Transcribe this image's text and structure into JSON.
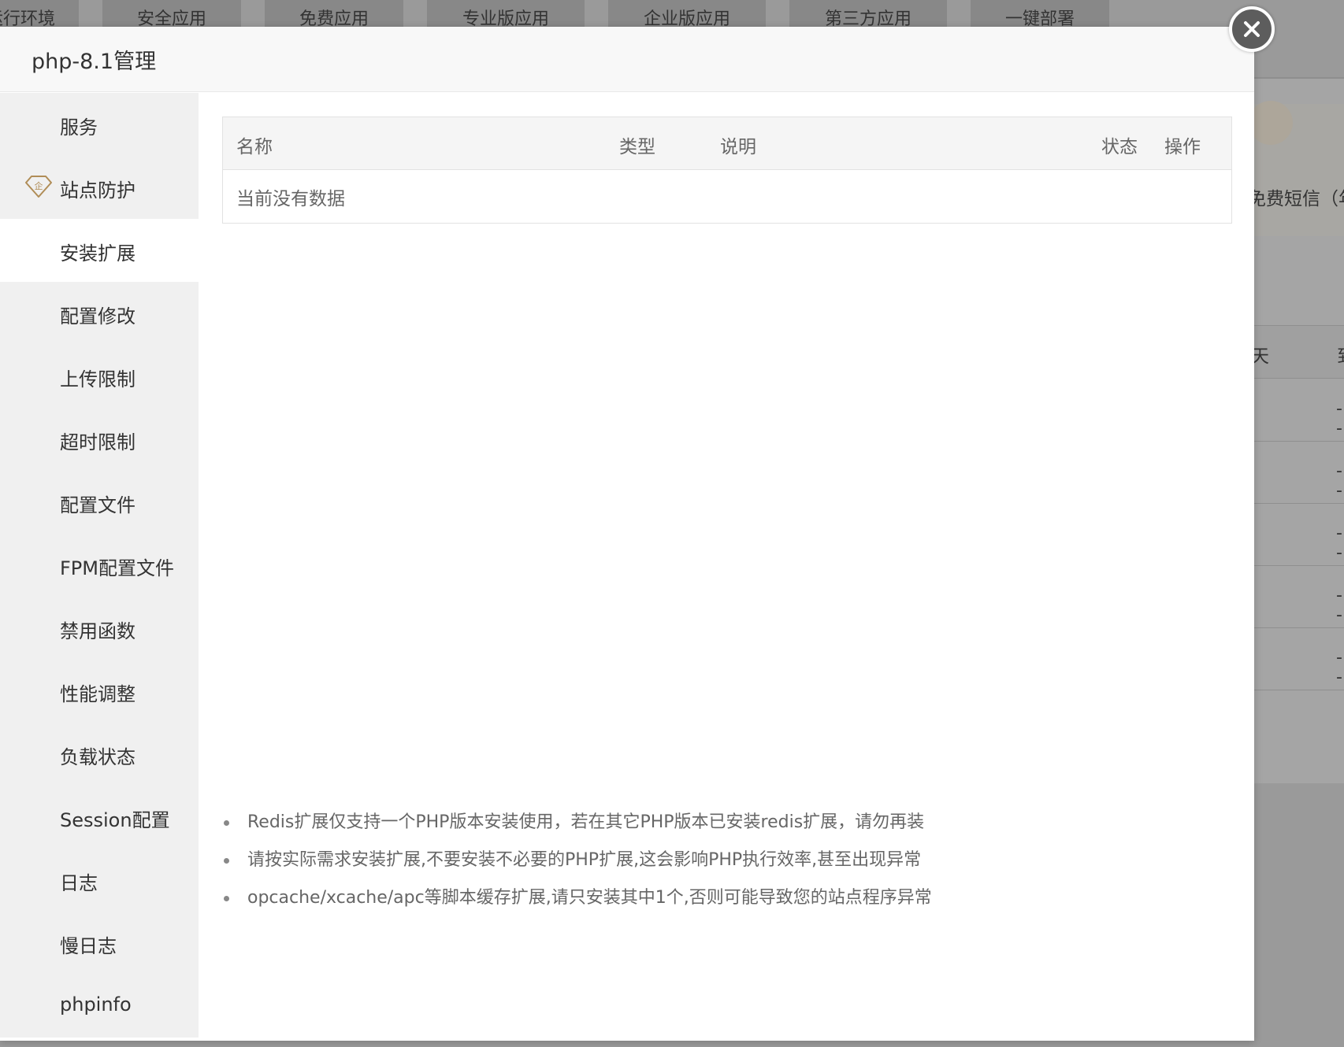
{
  "background": {
    "tabs": [
      "运行环境",
      "安全应用",
      "免费应用",
      "专业版应用",
      "企业版应用",
      "第三方应用",
      "一键部署"
    ],
    "promo_text": "免费短信（年付",
    "table_head": [
      "天",
      "到"
    ],
    "row_placeholder": "--"
  },
  "modal": {
    "title": "php-8.1管理",
    "close_label": "×"
  },
  "sidebar": {
    "items": [
      {
        "label": "服务"
      },
      {
        "label": "站点防护",
        "icon": "enterprise-diamond-icon",
        "icon_text": "企"
      },
      {
        "label": "安装扩展",
        "active": true
      },
      {
        "label": "配置修改"
      },
      {
        "label": "上传限制"
      },
      {
        "label": "超时限制"
      },
      {
        "label": "配置文件"
      },
      {
        "label": "FPM配置文件"
      },
      {
        "label": "禁用函数"
      },
      {
        "label": "性能调整"
      },
      {
        "label": "负载状态"
      },
      {
        "label": "Session配置"
      },
      {
        "label": "日志"
      },
      {
        "label": "慢日志"
      },
      {
        "label": "phpinfo"
      }
    ]
  },
  "extensions_table": {
    "columns": [
      "名称",
      "类型",
      "说明",
      "状态",
      "操作"
    ],
    "empty_text": "当前没有数据"
  },
  "notes": [
    "Redis扩展仅支持一个PHP版本安装使用，若在其它PHP版本已安装redis扩展，请勿再装",
    "请按实际需求安装扩展,不要安装不必要的PHP扩展,这会影响PHP执行效率,甚至出现异常",
    "opcache/xcache/apc等脚本缓存扩展,请只安装其中1个,否则可能导致您的站点程序异常"
  ],
  "colors": {
    "active_nav": "#ffffff",
    "sidebar_bg": "#f0f0f0",
    "icon_gold": "#b08d57"
  }
}
